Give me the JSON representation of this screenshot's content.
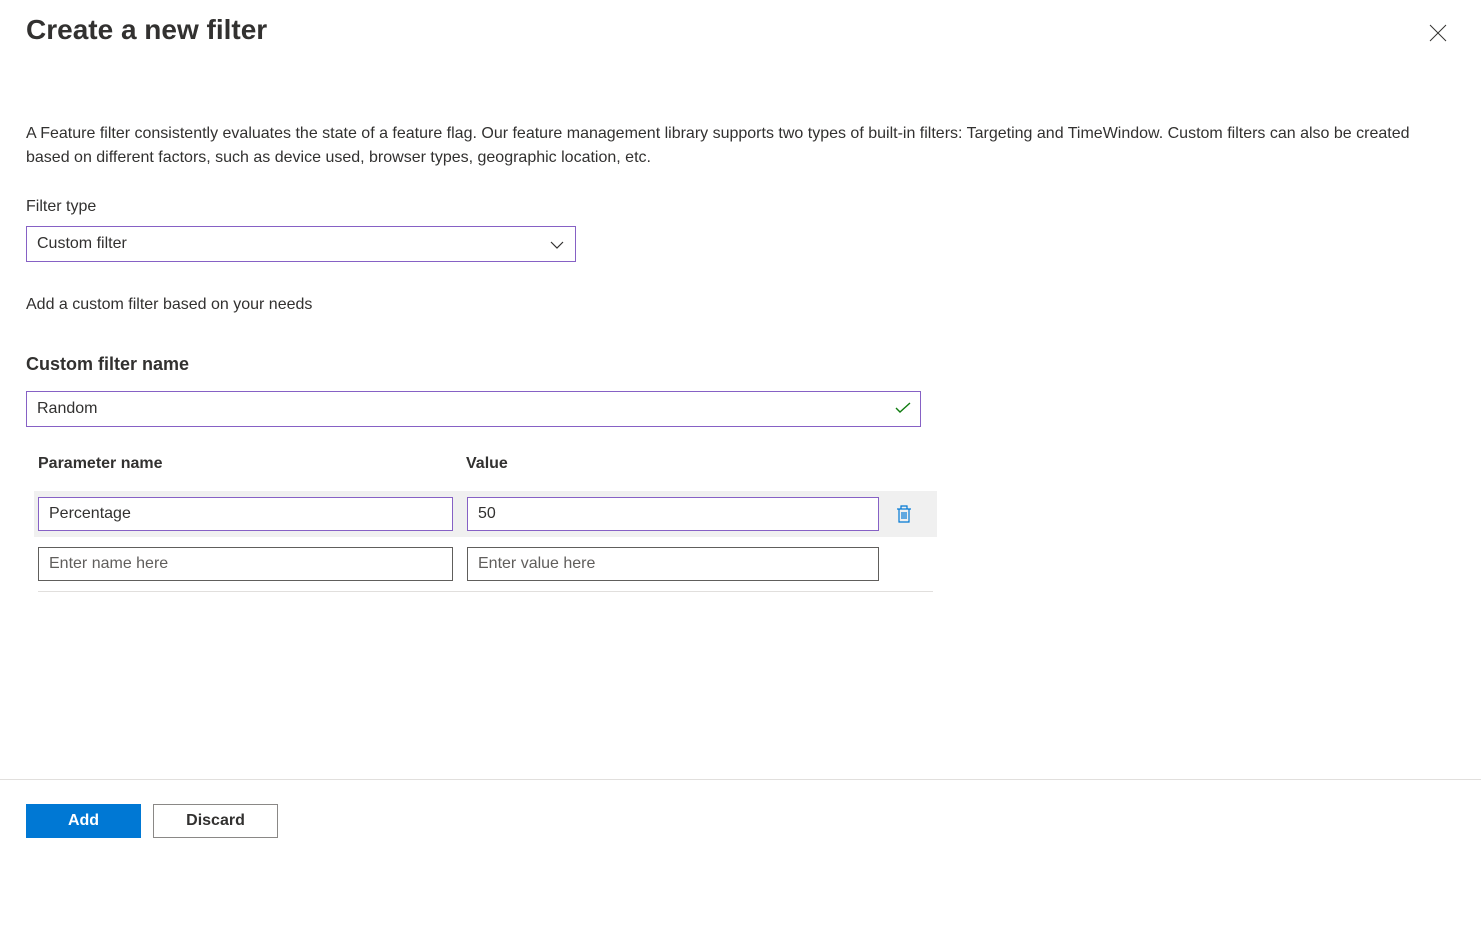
{
  "header": {
    "title": "Create a new filter"
  },
  "description": "A Feature filter consistently evaluates the state of a feature flag. Our feature management library supports two types of built-in filters: Targeting and TimeWindow. Custom filters can also be created based on different factors, such as device used, browser types, geographic location, etc.",
  "filterType": {
    "label": "Filter type",
    "selected": "Custom filter",
    "helper": "Add a custom filter based on your needs"
  },
  "customFilterName": {
    "label": "Custom filter name",
    "value": "Random"
  },
  "parameters": {
    "headerName": "Parameter name",
    "headerValue": "Value",
    "rows": [
      {
        "name": "Percentage",
        "value": "50"
      }
    ],
    "placeholderName": "Enter name here",
    "placeholderValue": "Enter value here"
  },
  "footer": {
    "add": "Add",
    "discard": "Discard"
  }
}
